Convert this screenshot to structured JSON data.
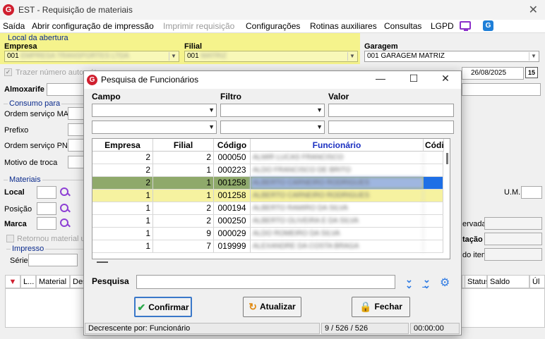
{
  "window": {
    "title": "EST - Requisição de materiais"
  },
  "menu": {
    "items": [
      {
        "label": "Saída"
      },
      {
        "label": "Abrir configuração de impressão"
      },
      {
        "label": "Imprimir requisição"
      },
      {
        "label": "Configurações"
      },
      {
        "label": "Rotinas auxiliares"
      },
      {
        "label": "Consultas"
      },
      {
        "label": "LGPD"
      }
    ]
  },
  "form": {
    "local_abertura_title": "Local da abertura",
    "empresa_label": "Empresa",
    "empresa_value": "001",
    "filial_label": "Filial",
    "filial_value": "001",
    "garagem_label": "Garagem",
    "garagem_value": "001 GARAGEM MATRIZ",
    "trazer_numero_label": "Trazer número automát",
    "data_value": "26/08/2025",
    "date_picker_label": "15",
    "almoxarife_label": "Almoxarife",
    "consumo_title": "Consumo para",
    "os_man_label": "Ordem serviço MAN",
    "prefixo_label": "Prefixo",
    "os_pne_label": "Ordem serviço PNE",
    "motivo_label": "Motivo de troca",
    "materiais_title": "Materiais",
    "local_label": "Local",
    "posicao_label": "Posição",
    "marca_label": "Marca",
    "um_label": "U.M.",
    "retornou_label": "Retornou material usad",
    "impresso_title": "Impresso",
    "serie_label": "Série",
    "ervada_label": "ervada",
    "tacao_label": "tação",
    "do_item_label": "do item",
    "grid_cols": [
      "L...",
      "Material",
      "Des",
      "Status",
      "Saldo",
      "Úl"
    ]
  },
  "dialog": {
    "title": "Pesquisa de Funcionários",
    "campo_label": "Campo",
    "filtro_label": "Filtro",
    "valor_label": "Valor",
    "columns": [
      "Empresa",
      "Filial",
      "Código",
      "Funcionário",
      "Códi"
    ],
    "rows": [
      {
        "empresa": "2",
        "filial": "2",
        "codigo": "000050",
        "funcionario": "ALMIR LUCAS FRANCISCO",
        "state": "normal"
      },
      {
        "empresa": "2",
        "filial": "1",
        "codigo": "000223",
        "funcionario": "ALDO FRANCISCO DE BRITO",
        "state": "normal"
      },
      {
        "empresa": "2",
        "filial": "1",
        "codigo": "001258",
        "funcionario": "ALBERTO CARNEIRO RODRIGUES",
        "state": "selected"
      },
      {
        "empresa": "1",
        "filial": "1",
        "codigo": "001258",
        "funcionario": "ALBERTO CARNEIRO RODRIGUES",
        "state": "highlight"
      },
      {
        "empresa": "1",
        "filial": "2",
        "codigo": "000194",
        "funcionario": "ALBERTO RAMIRO DA SILVA",
        "state": "normal"
      },
      {
        "empresa": "1",
        "filial": "2",
        "codigo": "000250",
        "funcionario": "ALBERTO OLIVEIRA E DA SILVA",
        "state": "normal"
      },
      {
        "empresa": "1",
        "filial": "9",
        "codigo": "000029",
        "funcionario": "ALDO ROMEIRO DA SILVA",
        "state": "normal"
      },
      {
        "empresa": "1",
        "filial": "7",
        "codigo": "019999",
        "funcionario": "ALEXANDRE DA COSTA BRAGA",
        "state": "normal"
      }
    ],
    "pesquisa_label": "Pesquisa",
    "confirm_label": "Confirmar",
    "refresh_label": "Atualizar",
    "close_label": "Fechar",
    "status_sort": "Decrescente por: Funcionário",
    "status_count": "9 / 526 / 526",
    "status_time": "00:00:00"
  },
  "colors": {
    "accent_blue": "#2f7be3",
    "selected_row": "#8fa96b",
    "highlight_row": "#f6f2a0",
    "yellow_panel": "#f5f38c"
  }
}
